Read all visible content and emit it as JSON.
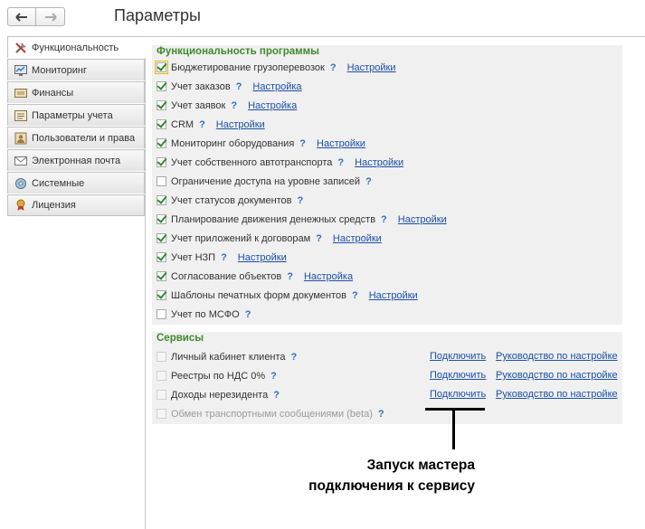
{
  "header": {
    "title": "Параметры"
  },
  "tabs": [
    {
      "label": "Функциональность",
      "icon": "tools-icon"
    },
    {
      "label": "Мониторинг",
      "icon": "monitor-icon"
    },
    {
      "label": "Финансы",
      "icon": "finance-icon"
    },
    {
      "label": "Параметры учета",
      "icon": "accounting-icon"
    },
    {
      "label": "Пользователи и права",
      "icon": "users-icon"
    },
    {
      "label": "Электронная почта",
      "icon": "email-icon"
    },
    {
      "label": "Системные",
      "icon": "system-icon"
    },
    {
      "label": "Лицензия",
      "icon": "license-icon"
    }
  ],
  "functionality": {
    "title": "Функциональность программы",
    "items": [
      {
        "label": "Бюджетирование грузоперевозок",
        "checked": true,
        "help": "?",
        "link": "Настройки"
      },
      {
        "label": "Учет заказов",
        "checked": true,
        "help": "?",
        "link": "Настройка"
      },
      {
        "label": "Учет заявок",
        "checked": true,
        "help": "?",
        "link": "Настройка"
      },
      {
        "label": "CRM",
        "checked": true,
        "help": "?",
        "link": "Настройки"
      },
      {
        "label": "Мониторинг оборудования",
        "checked": true,
        "help": "?",
        "link": "Настройки"
      },
      {
        "label": "Учет собственного автотранспорта",
        "checked": true,
        "help": "?",
        "link": "Настройки"
      },
      {
        "label": "Ограничение доступа на уровне записей",
        "checked": false,
        "help": "?",
        "link": ""
      },
      {
        "label": "Учет статусов документов",
        "checked": true,
        "help": "?",
        "link": ""
      },
      {
        "label": "Планирование движения денежных средств",
        "checked": true,
        "help": "?",
        "link": "Настройки"
      },
      {
        "label": "Учет приложений к договорам",
        "checked": true,
        "help": "?",
        "link": "Настройки"
      },
      {
        "label": "Учет НЗП",
        "checked": true,
        "help": "?",
        "link": "Настройки"
      },
      {
        "label": "Согласование объектов",
        "checked": true,
        "help": "?",
        "link": "Настройка"
      },
      {
        "label": "Шаблоны печатных форм документов",
        "checked": true,
        "help": "?",
        "link": "Настройки"
      },
      {
        "label": "Учет по МСФО",
        "checked": false,
        "help": "?",
        "link": ""
      }
    ]
  },
  "services": {
    "title": "Сервисы",
    "items": [
      {
        "label": "Личный кабинет клиента",
        "help": "?",
        "connect": "Подключить",
        "guide": "Руководство по настройке",
        "disabled": false
      },
      {
        "label": "Реестры по НДС 0%",
        "help": "?",
        "connect": "Подключить",
        "guide": "Руководство по настройке",
        "disabled": false
      },
      {
        "label": "Доходы нерезидента",
        "help": "?",
        "connect": "Подключить",
        "guide": "Руководство по настройке",
        "disabled": false
      },
      {
        "label": "Обмен транспортными сообщениями (beta)",
        "help": "?",
        "connect": "",
        "guide": "",
        "disabled": true
      }
    ]
  },
  "callout": {
    "line1": "Запуск мастера",
    "line2": "подключения к сервису"
  }
}
